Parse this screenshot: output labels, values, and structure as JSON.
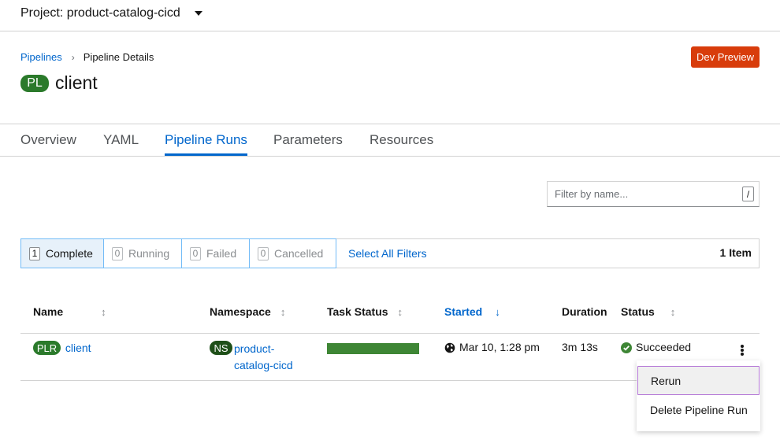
{
  "topbar": {
    "project_label": "Project: product-catalog-cicd"
  },
  "breadcrumb": {
    "parent": "Pipelines",
    "current": "Pipeline Details"
  },
  "dev_preview": "Dev Preview",
  "title": {
    "badge": "PL",
    "name": "client"
  },
  "tabs": [
    {
      "label": "Overview"
    },
    {
      "label": "YAML"
    },
    {
      "label": "Pipeline Runs"
    },
    {
      "label": "Parameters"
    },
    {
      "label": "Resources"
    }
  ],
  "active_tab": "Pipeline Runs",
  "search": {
    "placeholder": "Filter by name...",
    "shortcut": "/"
  },
  "row_filters": [
    {
      "count": "1",
      "label": "Complete",
      "selected": true
    },
    {
      "count": "0",
      "label": "Running",
      "selected": false
    },
    {
      "count": "0",
      "label": "Failed",
      "selected": false
    },
    {
      "count": "0",
      "label": "Cancelled",
      "selected": false
    }
  ],
  "select_all": "Select All Filters",
  "item_count": "1 Item",
  "columns": [
    "Name",
    "Namespace",
    "Task Status",
    "Started",
    "Duration",
    "Status"
  ],
  "sorted_column": "Started",
  "rows": [
    {
      "name_badge": "PLR",
      "name": "client",
      "ns_badge": "NS",
      "namespace_line1": "product-",
      "namespace_line2": "catalog-cicd",
      "task_status_complete_fraction": 1.0,
      "task_status_color": "#3e8635",
      "started": "Mar 10, 1:28 pm",
      "duration": "3m 13s",
      "status": "Succeeded"
    }
  ],
  "kebab_menu": {
    "items": [
      "Rerun",
      "Delete Pipeline Run"
    ]
  },
  "colors": {
    "accent": "#0066cc",
    "dev_preview": "#d83c0b",
    "pl_badge": "#2b7a2b",
    "ns_badge": "#1e4f18",
    "success": "#3e8635"
  },
  "icons": {
    "started": "globe-icon",
    "status": "check-circle-icon",
    "sort": "sort-arrows-icon"
  }
}
